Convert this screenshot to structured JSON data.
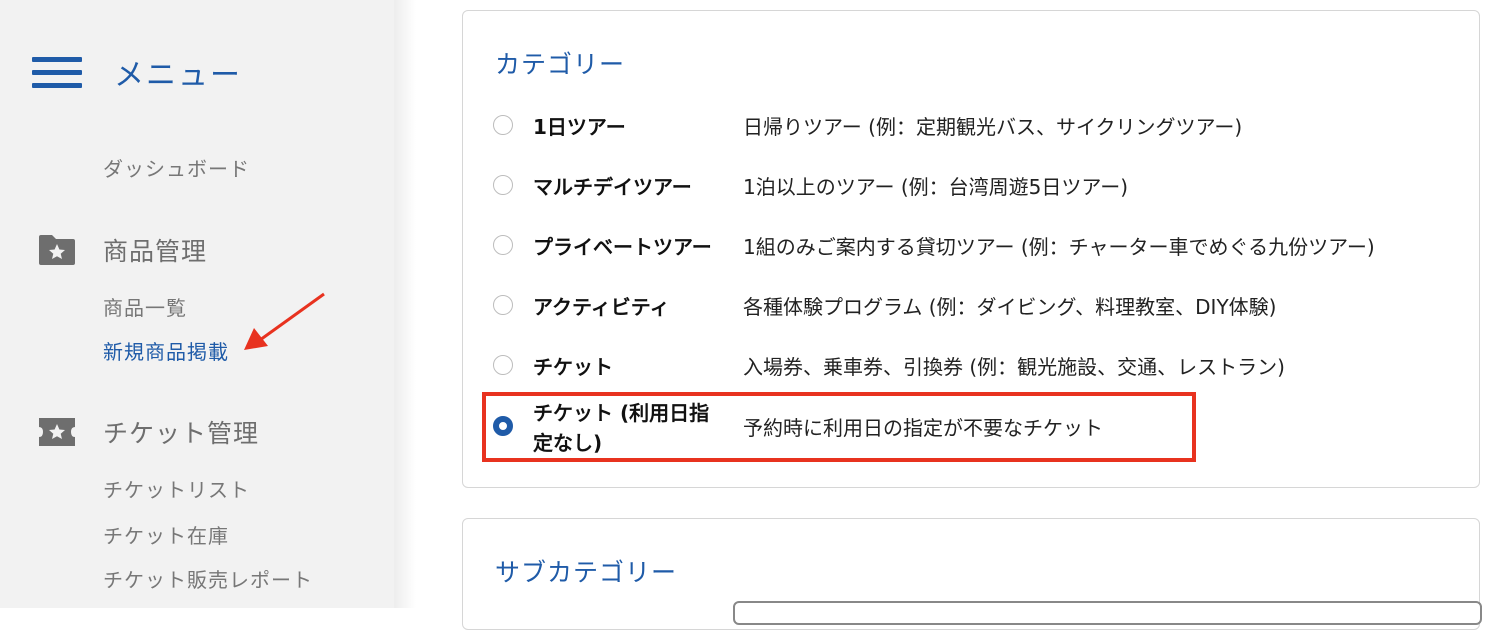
{
  "sidebar": {
    "menu_title": "メニュー",
    "dashboard": "ダッシュボード",
    "product_section": {
      "icon": "folder-star-icon",
      "title": "商品管理",
      "items": [
        "商品一覧",
        "新規商品掲載"
      ]
    },
    "ticket_section": {
      "icon": "ticket-star-icon",
      "title": "チケット管理",
      "items": [
        "チケットリスト",
        "チケット在庫",
        "チケット販売レポート"
      ]
    }
  },
  "category": {
    "title": "カテゴリー",
    "selected_index": 5,
    "options": [
      {
        "name": "1日ツアー",
        "desc": "日帰りツアー (例：定期観光バス、サイクリングツアー)"
      },
      {
        "name": "マルチデイツアー",
        "desc": "1泊以上のツアー (例：台湾周遊5日ツアー)"
      },
      {
        "name": "プライベートツアー",
        "desc": "1組のみご案内する貸切ツアー (例：チャーター車でめぐる九份ツアー)"
      },
      {
        "name": "アクティビティ",
        "desc": "各種体験プログラム (例：ダイビング、料理教室、DIY体験)"
      },
      {
        "name": "チケット",
        "desc": "入場券、乗車券、引換券 (例：観光施設、交通、レストラン)"
      },
      {
        "name": "チケット (利用日指定なし)",
        "desc": "予約時に利用日の指定が不要なチケット"
      }
    ]
  },
  "subcategory": {
    "title": "サブカテゴリー"
  },
  "colors": {
    "accent": "#1f5ba8",
    "highlight": "#e8321f",
    "sidebar_bg": "#f2f2f2"
  }
}
